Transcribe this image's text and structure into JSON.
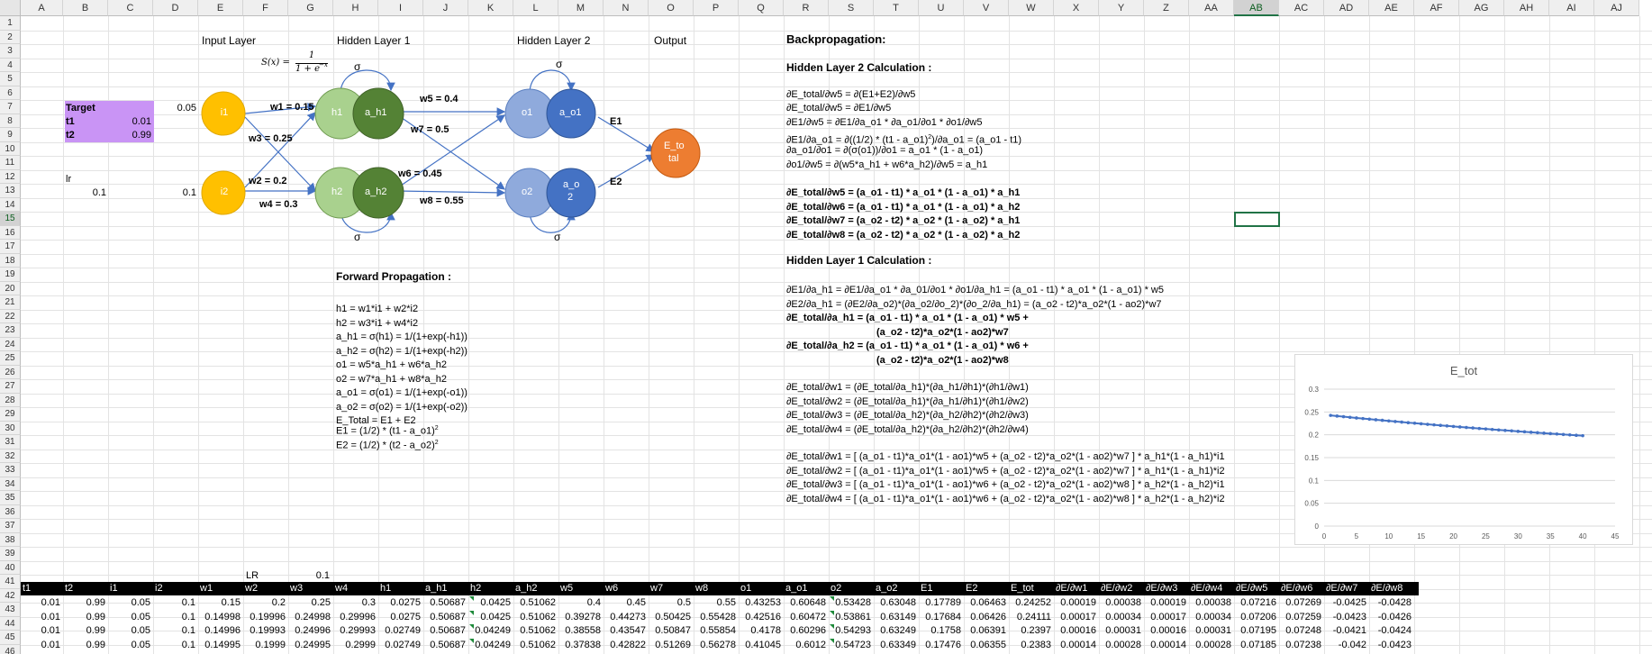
{
  "columns": [
    "A",
    "B",
    "C",
    "D",
    "E",
    "F",
    "G",
    "H",
    "I",
    "J",
    "K",
    "L",
    "M",
    "N",
    "O",
    "P",
    "Q",
    "R",
    "S",
    "T",
    "U",
    "V",
    "W",
    "X",
    "Y",
    "Z",
    "AA",
    "AB",
    "AC",
    "AD",
    "AE",
    "AF",
    "AG",
    "AH",
    "AI",
    "AJ"
  ],
  "selected_column": "AB",
  "rows": [
    "1",
    "2",
    "3",
    "4",
    "5",
    "6",
    "7",
    "8",
    "9",
    "10",
    "11",
    "12",
    "13",
    "14",
    "15",
    "16",
    "17",
    "18",
    "19",
    "20",
    "21",
    "22",
    "23",
    "24",
    "25",
    "26",
    "27",
    "28",
    "29",
    "30",
    "31",
    "32",
    "33",
    "34",
    "35",
    "36",
    "37",
    "38",
    "39",
    "40",
    "41",
    "42",
    "43",
    "44",
    "45",
    "46"
  ],
  "selected_row": "15",
  "target": {
    "label": "Target",
    "t1_label": "t1",
    "t1": "0.01",
    "t2_label": "t2",
    "t2": "0.99"
  },
  "lr": {
    "label": "lr",
    "value": "0.1"
  },
  "inputs": {
    "i1_value": "0.05",
    "i2_value": "0.1"
  },
  "network": {
    "input_layer": "Input Layer",
    "hidden1": "Hidden Layer 1",
    "hidden2": "Hidden Layer 2",
    "output": "Output",
    "sigma_formula_lhs": "S(x) =",
    "sigma_formula_num": "1",
    "sigma_formula_den": "1 + e",
    "sigma_formula_exp": "−x",
    "sigma": "σ",
    "nodes": {
      "i1": "i1",
      "i2": "i2",
      "h1": "h1",
      "a_h1": "a_h1",
      "h2": "h2",
      "a_h2": "a_h2",
      "o1": "o1",
      "a_o1": "a_o1",
      "o2": "o2",
      "a_o2_l1": "a_o",
      "a_o2_l2": "2",
      "etot_l1": "E_to",
      "etot_l2": "tal"
    },
    "weights": {
      "w1": "w1 = 0.15",
      "w2": "w2 = 0.2",
      "w3": "w3 = 0.25",
      "w4": "w4 = 0.3",
      "w5": "w5 = 0.4",
      "w6": "w6 = 0.45",
      "w7": "w7 = 0.5",
      "w8": "w8 = 0.55"
    },
    "errors": {
      "e1": "E1",
      "e2": "E2"
    }
  },
  "forward": {
    "title": "Forward Propagation :",
    "lines": [
      "h1 = w1*i1 + w2*i2",
      "h2 = w3*i1 + w4*i2",
      "a_h1 = σ(h1) = 1/(1+exp(-h1))",
      "a_h2 = σ(h2) = 1/(1+exp(-h2))",
      "o1 = w5*a_h1 + w6*a_h2",
      "o2 = w7*a_h1 + w8*a_h2",
      "a_o1 = σ(o1) = 1/(1+exp(-o1))",
      "a_o2 = σ(o2) = 1/(1+exp(-o2))",
      "E_Total = E1 + E2"
    ],
    "e1": "E1 = (1/2) * (t1 - a_o1)",
    "e2": "E2 = (1/2) * (t2 - a_o2)",
    "sq": "2"
  },
  "backprop": {
    "title": "Backpropagation:",
    "h2_title": "Hidden Layer 2 Calculation :",
    "h2_lines": [
      "∂E_total/∂w5 = ∂(E1+E2)/∂w5",
      "∂E_total/∂w5 = ∂E1/∂w5",
      "∂E1/∂w5  = ∂E1/∂a_o1 * ∂a_o1/∂o1 * ∂o1/∂w5"
    ],
    "h2_line4a": "∂E1/∂a_o1 = ∂((1/2) * (t1 - a_o1)",
    "h2_line4sup": "2",
    "h2_line4b": ")/∂a_o1 = (a_o1 - t1)",
    "h2_lines2": [
      "∂a_o1/∂o1 = ∂(σ(o1))/∂o1 = a_o1 * (1 - a_o1)",
      "∂o1/∂w5 = ∂(w5*a_h1 + w6*a_h2)/∂w5 = a_h1"
    ],
    "h2_bold": [
      "∂E_total/∂w5 = (a_o1 - t1) * a_o1 * (1 - a_o1) * a_h1",
      "∂E_total/∂w6 = (a_o1 - t1) * a_o1 * (1 - a_o1) * a_h2",
      "∂E_total/∂w7 = (a_o2 - t2) * a_o2 * (1 - a_o2) * a_h1",
      "∂E_total/∂w8 = (a_o2 - t2) * a_o2 * (1 - a_o2) * a_h2"
    ],
    "h1_title": "Hidden Layer 1 Calculation :",
    "h1_lines": [
      "∂E1/∂a_h1 = ∂E1/∂a_o1 * ∂a_01/∂o1 * ∂o1/∂a_h1 = (a_o1 - t1) * a_o1 * (1 - a_o1) * w5",
      "∂E2/∂a_h1 = (∂E2/∂a_o2)*(∂a_o2/∂o_2)*(∂o_2/∂a_h1) = (a_o2 - t2)*a_o2*(1 - ao2)*w7"
    ],
    "h1_bold": [
      "∂E_total/∂a_h1 = (a_o1 - t1) * a_o1 * (1 - a_o1) * w5 +",
      "(a_o2 - t2)*a_o2*(1 - ao2)*w7",
      "∂E_total/∂a_h2 = (a_o1 - t1) * a_o1 * (1 - a_o1) * w6 +",
      "(a_o2 - t2)*a_o2*(1 - ao2)*w8"
    ],
    "w_lines": [
      "∂E_total/∂w1 = (∂E_total/∂a_h1)*(∂a_h1/∂h1)*(∂h1/∂w1)",
      "∂E_total/∂w2 = (∂E_total/∂a_h1)*(∂a_h1/∂h1)*(∂h1/∂w2)",
      "∂E_total/∂w3 = (∂E_total/∂a_h2)*(∂a_h2/∂h2)*(∂h2/∂w3)",
      "∂E_total/∂w4 = (∂E_total/∂a_h2)*(∂a_h2/∂h2)*(∂h2/∂w4)"
    ],
    "full_lines": [
      "∂E_total/∂w1 = [ (a_o1 - t1)*a_o1*(1 - ao1)*w5 + (a_o2 - t2)*a_o2*(1 - ao2)*w7 ] * a_h1*(1 - a_h1)*i1",
      "∂E_total/∂w2 = [ (a_o1 - t1)*a_o1*(1 - ao1)*w5 + (a_o2 - t2)*a_o2*(1 - ao2)*w7 ] * a_h1*(1 - a_h1)*i2",
      "∂E_total/∂w3 = [ (a_o1 - t1)*a_o1*(1 - ao1)*w6 + (a_o2 - t2)*a_o2*(1 - ao2)*w8 ] * a_h2*(1 - a_h2)*i1",
      "∂E_total/∂w4 = [ (a_o1 - t1)*a_o1*(1 - ao1)*w6 + (a_o2 - t2)*a_o2*(1 - ao2)*w8 ] * a_h2*(1 - a_h2)*i2"
    ]
  },
  "lr_row": {
    "label": "LR",
    "value": "0.1"
  },
  "table": {
    "headers": [
      "t1",
      "t2",
      "i1",
      "i2",
      "w1",
      "w2",
      "w3",
      "w4",
      "h1",
      "a_h1",
      "h2",
      "a_h2",
      "w5",
      "w6",
      "w7",
      "w8",
      "o1",
      "a_o1",
      "o2",
      "a_o2",
      "E1",
      "E2",
      "E_tot",
      "∂E/∂w1",
      "∂E/∂w2",
      "∂E/∂w3",
      "∂E/∂w4",
      "∂E/∂w5",
      "∂E/∂w6",
      "∂E/∂w7",
      "∂E/∂w8"
    ],
    "rows": [
      [
        "0.01",
        "0.99",
        "0.05",
        "0.1",
        "0.15",
        "0.2",
        "0.25",
        "0.3",
        "0.0275",
        "0.50687",
        "0.0425",
        "0.51062",
        "0.4",
        "0.45",
        "0.5",
        "0.55",
        "0.43253",
        "0.60648",
        "0.53428",
        "0.63048",
        "0.17789",
        "0.06463",
        "0.24252",
        "0.00019",
        "0.00038",
        "0.00019",
        "0.00038",
        "0.07216",
        "0.07269",
        "-0.0425",
        "-0.0428"
      ],
      [
        "0.01",
        "0.99",
        "0.05",
        "0.1",
        "0.14998",
        "0.19996",
        "0.24998",
        "0.29996",
        "0.0275",
        "0.50687",
        "0.0425",
        "0.51062",
        "0.39278",
        "0.44273",
        "0.50425",
        "0.55428",
        "0.42516",
        "0.60472",
        "0.53861",
        "0.63149",
        "0.17684",
        "0.06426",
        "0.24111",
        "0.00017",
        "0.00034",
        "0.00017",
        "0.00034",
        "0.07206",
        "0.07259",
        "-0.0423",
        "-0.0426"
      ],
      [
        "0.01",
        "0.99",
        "0.05",
        "0.1",
        "0.14996",
        "0.19993",
        "0.24996",
        "0.29993",
        "0.02749",
        "0.50687",
        "0.04249",
        "0.51062",
        "0.38558",
        "0.43547",
        "0.50847",
        "0.55854",
        "0.4178",
        "0.60296",
        "0.54293",
        "0.63249",
        "0.1758",
        "0.06391",
        "0.2397",
        "0.00016",
        "0.00031",
        "0.00016",
        "0.00031",
        "0.07195",
        "0.07248",
        "-0.0421",
        "-0.0424"
      ],
      [
        "0.01",
        "0.99",
        "0.05",
        "0.1",
        "0.14995",
        "0.1999",
        "0.24995",
        "0.2999",
        "0.02749",
        "0.50687",
        "0.04249",
        "0.51062",
        "0.37838",
        "0.42822",
        "0.51269",
        "0.56278",
        "0.41045",
        "0.6012",
        "0.54723",
        "0.63349",
        "0.17476",
        "0.06355",
        "0.2383",
        "0.00014",
        "0.00028",
        "0.00014",
        "0.00028",
        "0.07185",
        "0.07238",
        "-0.042",
        "-0.0423"
      ]
    ]
  },
  "chart_data": {
    "type": "line",
    "title": "E_tot",
    "xlim": [
      0,
      45
    ],
    "ylim": [
      0,
      0.3
    ],
    "xticks": [
      "0",
      "5",
      "10",
      "15",
      "20",
      "25",
      "30",
      "35",
      "40",
      "45"
    ],
    "yticks": [
      "0",
      "0.05",
      "0.1",
      "0.15",
      "0.2",
      "0.25",
      "0.3"
    ],
    "x": [
      1,
      2,
      3,
      4,
      5,
      6,
      7,
      8,
      9,
      10,
      11,
      12,
      13,
      14,
      15,
      16,
      17,
      18,
      19,
      20,
      21,
      22,
      23,
      24,
      25,
      26,
      27,
      28,
      29,
      30,
      31,
      32,
      33,
      34,
      35,
      36,
      37,
      38,
      39,
      40
    ],
    "y": [
      0.2425,
      0.2411,
      0.2397,
      0.2383,
      0.2369,
      0.2356,
      0.2343,
      0.233,
      0.2317,
      0.2304,
      0.2291,
      0.2279,
      0.2266,
      0.2254,
      0.2242,
      0.223,
      0.2218,
      0.2206,
      0.2195,
      0.2183,
      0.2172,
      0.2161,
      0.215,
      0.2139,
      0.2128,
      0.2117,
      0.2107,
      0.2096,
      0.2086,
      0.2076,
      0.2066,
      0.2056,
      0.2046,
      0.2036,
      0.2026,
      0.2017,
      0.2007,
      0.1998,
      0.1989,
      0.198
    ],
    "color": "#4472c4",
    "grid": true
  }
}
